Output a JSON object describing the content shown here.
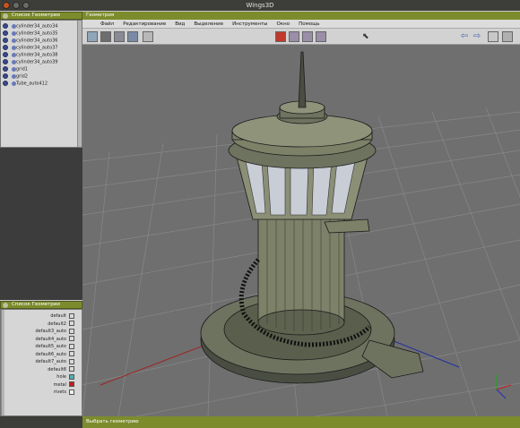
{
  "window": {
    "title": "Wings3D"
  },
  "geometry_list": {
    "title": "Список Геометрии",
    "items": [
      {
        "label": "cylinder34_auto34"
      },
      {
        "label": "cylinder34_auto35"
      },
      {
        "label": "cylinder34_auto36"
      },
      {
        "label": "cylinder34_auto37"
      },
      {
        "label": "cylinder34_auto38"
      },
      {
        "label": "cylinder34_auto39"
      },
      {
        "label": "grid1"
      },
      {
        "label": "grid2"
      },
      {
        "label": "Tube_auto412"
      }
    ]
  },
  "materials": {
    "title": "Список Геометрии",
    "items": [
      {
        "label": "default",
        "color": "#d8d8d8"
      },
      {
        "label": "default2",
        "color": "#d8d8d8"
      },
      {
        "label": "default3_auto",
        "color": "#d8d8d8"
      },
      {
        "label": "default4_auto",
        "color": "#d8d8d8"
      },
      {
        "label": "default5_auto",
        "color": "#d8d8d8"
      },
      {
        "label": "default6_auto",
        "color": "#d8d8d8"
      },
      {
        "label": "default7_auto",
        "color": "#d8d8d8"
      },
      {
        "label": "default8",
        "color": "#d8d8d8"
      },
      {
        "label": "hole",
        "color": "#4bb0b0"
      },
      {
        "label": "metal",
        "color": "#c02020"
      },
      {
        "label": "rivets",
        "color": "#f0f0f0"
      }
    ]
  },
  "geometry_window": {
    "title": "Геометрия"
  },
  "menu": [
    "Файл",
    "Редактирование",
    "Вид",
    "Выделение",
    "Инструменты",
    "Окно",
    "Помощь"
  ],
  "status": {
    "text": "Выбрать геометрию"
  },
  "colors": {
    "accent": "#7c8c2c",
    "viewport_bg": "#6f6f6f"
  }
}
